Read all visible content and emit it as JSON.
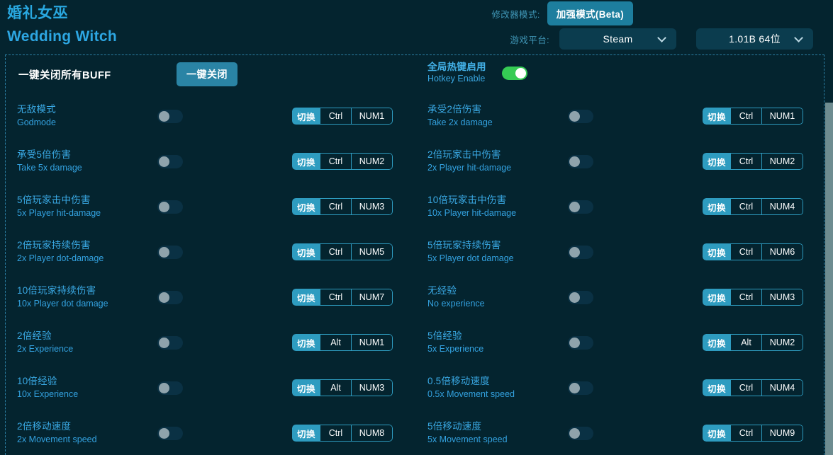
{
  "header": {
    "title_cn": "婚礼女巫",
    "title_en": "Wedding Witch",
    "trainer_mode_label": "修改器模式:",
    "trainer_mode_button": "加强模式(Beta)",
    "platform_label": "游戏平台:",
    "platform_value": "Steam",
    "version_value": "1.01B 64位"
  },
  "panel": {
    "close_all_label": "一键关闭所有BUFF",
    "close_all_button": "一键关闭",
    "hotkey_cn": "全局热键启用",
    "hotkey_en": "Hotkey Enable",
    "hotkey_enabled": true
  },
  "toggle_label": "切换",
  "rows_left": [
    {
      "cn": "无敌模式",
      "en": "Godmode",
      "on": false,
      "mod": "Ctrl",
      "key": "NUM1"
    },
    {
      "cn": "承受5倍伤害",
      "en": "Take 5x damage",
      "on": false,
      "mod": "Ctrl",
      "key": "NUM2"
    },
    {
      "cn": "5倍玩家击中伤害",
      "en": "5x Player hit-damage",
      "on": false,
      "mod": "Ctrl",
      "key": "NUM3"
    },
    {
      "cn": "2倍玩家持续伤害",
      "en": "2x Player dot-damage",
      "on": false,
      "mod": "Ctrl",
      "key": "NUM5"
    },
    {
      "cn": "10倍玩家持续伤害",
      "en": "10x Player dot damage",
      "on": false,
      "mod": "Ctrl",
      "key": "NUM7"
    },
    {
      "cn": "2倍经验",
      "en": "2x Experience",
      "on": false,
      "mod": "Alt",
      "key": "NUM1"
    },
    {
      "cn": "10倍经验",
      "en": "10x Experience",
      "on": false,
      "mod": "Alt",
      "key": "NUM3"
    },
    {
      "cn": "2倍移动速度",
      "en": "2x Movement speed",
      "on": false,
      "mod": "Ctrl",
      "key": "NUM8"
    }
  ],
  "rows_right": [
    {
      "cn": "承受2倍伤害",
      "en": "Take 2x damage",
      "on": false,
      "mod": "Ctrl",
      "key": "NUM1"
    },
    {
      "cn": "2倍玩家击中伤害",
      "en": "2x Player hit-damage",
      "on": false,
      "mod": "Ctrl",
      "key": "NUM2"
    },
    {
      "cn": "10倍玩家击中伤害",
      "en": "10x Player hit-damage",
      "on": false,
      "mod": "Ctrl",
      "key": "NUM4"
    },
    {
      "cn": "5倍玩家持续伤害",
      "en": "5x Player dot damage",
      "on": false,
      "mod": "Ctrl",
      "key": "NUM6"
    },
    {
      "cn": "无经验",
      "en": "No experience",
      "on": false,
      "mod": "Ctrl",
      "key": "NUM3"
    },
    {
      "cn": "5倍经验",
      "en": "5x Experience",
      "on": false,
      "mod": "Alt",
      "key": "NUM2"
    },
    {
      "cn": "0.5倍移动速度",
      "en": "0.5x Movement speed",
      "on": false,
      "mod": "Ctrl",
      "key": "NUM4"
    },
    {
      "cn": "5倍移动速度",
      "en": "5x Movement speed",
      "on": false,
      "mod": "Ctrl",
      "key": "NUM9"
    }
  ],
  "colors": {
    "background": "#04242f",
    "accent": "#2fa8e3",
    "teal_button": "#2a84a5",
    "toggle_badge": "#2e9cc0",
    "switch_on": "#35cb54",
    "border_dashed": "#2b7ea3",
    "scrollbar_thumb": "#6e8c90"
  }
}
